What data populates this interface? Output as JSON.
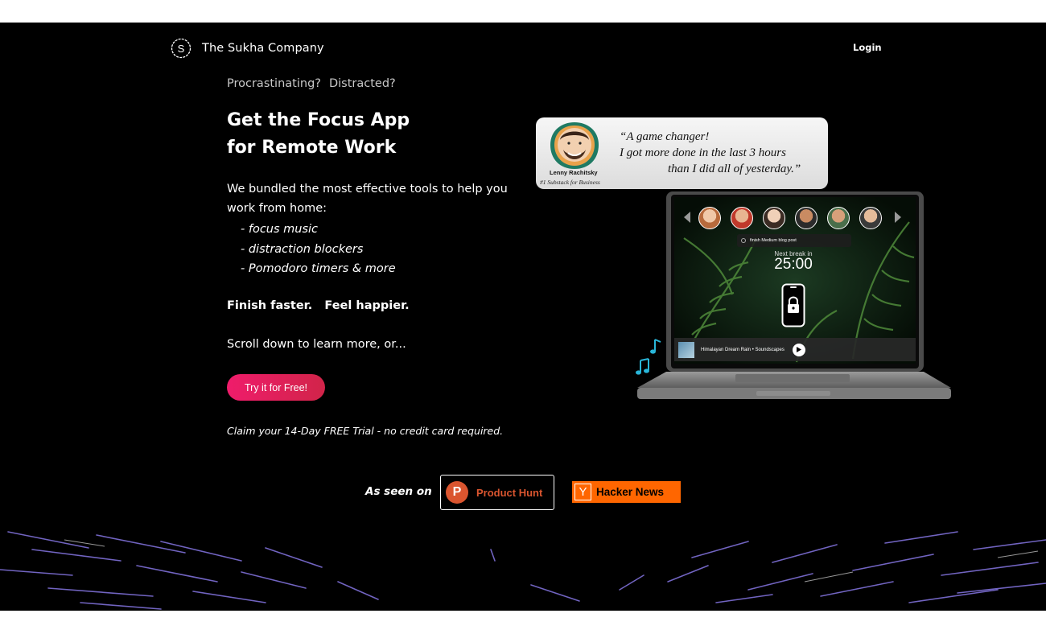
{
  "header": {
    "brand_logo_letter": "S",
    "brand_name": "The Sukha Company",
    "login_label": "Login"
  },
  "hero": {
    "eyebrow": [
      "Procrastinating?",
      "Distracted?"
    ],
    "headline_line1": "Get the Focus App",
    "headline_line2": "for Remote Work",
    "intro": "We bundled the most effective tools to help you work from home:",
    "features": [
      "- focus music",
      "- distraction blockers",
      "- Pomodoro timers & more"
    ],
    "tagline": "Finish faster.   Feel happier.",
    "scroll_note": "Scroll down to learn more, or...",
    "cta_label": "Try it for Free!",
    "trial_note": "Claim your 14-Day FREE Trial - no credit card required."
  },
  "testimonial": {
    "quote_line1": "“A game changer!",
    "quote_line2": "I got more done in the last 3 hours",
    "quote_line3": "than I did all of yesterday.”",
    "name": "Lenny Rachitsky",
    "role": "#1 Substack for Business"
  },
  "app_preview": {
    "task": "finish Medium blog post",
    "break_label": "Next break in",
    "timer": "25:00",
    "track": "Himalayan Dream Rain • Soundscapes"
  },
  "press": {
    "label": "As seen on",
    "product_hunt_letter": "P",
    "product_hunt": "Product Hunt",
    "hacker_news_letter": "Y",
    "hacker_news": "Hacker News"
  },
  "colors": {
    "accent": "#e91e63",
    "product_hunt": "#da552f",
    "hacker_news": "#ff6600",
    "background": "#000000"
  }
}
